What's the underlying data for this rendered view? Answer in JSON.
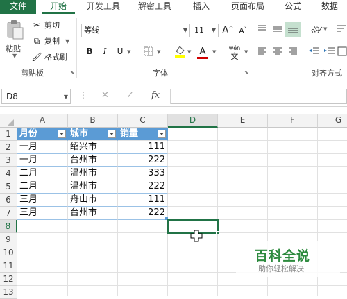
{
  "ribbon_tabs": {
    "file": "文件",
    "home": "开始",
    "developer": "开发工具",
    "decrypt": "解密工具",
    "insert": "插入",
    "page_layout": "页面布局",
    "formulas": "公式",
    "data": "数据"
  },
  "clipboard": {
    "paste": "粘贴",
    "cut": "剪切",
    "copy": "复制",
    "format_painter": "格式刷",
    "group_label": "剪贴板"
  },
  "font": {
    "name": "等线",
    "size": "11",
    "bold": "B",
    "italic": "I",
    "underline": "U",
    "grow": "A",
    "shrink": "A",
    "wen": "wén",
    "group_label": "字体",
    "highlight_color": "#ffff00",
    "font_color": "#d00000"
  },
  "alignment": {
    "group_label": "对齐方式"
  },
  "formula_bar": {
    "name_box": "D8",
    "cancel": "✕",
    "confirm": "✓",
    "fx": "fx",
    "value": ""
  },
  "columns": [
    "A",
    "B",
    "C",
    "D",
    "E",
    "F",
    "G"
  ],
  "rows": [
    "1",
    "2",
    "3",
    "4",
    "5",
    "6",
    "7",
    "8",
    "9",
    "10",
    "11",
    "12",
    "13"
  ],
  "table": {
    "headers": [
      "月份",
      "城市",
      "销量"
    ],
    "rows": [
      [
        "一月",
        "绍兴市",
        "111"
      ],
      [
        "一月",
        "台州市",
        "222"
      ],
      [
        "二月",
        "温州市",
        "333"
      ],
      [
        "二月",
        "温州市",
        "222"
      ],
      [
        "三月",
        "舟山市",
        "111"
      ],
      [
        "三月",
        "台州市",
        "222"
      ]
    ]
  },
  "selected_cell": "D8",
  "watermark": {
    "title": "百科全说",
    "subtitle": "助你轻松解决"
  },
  "colors": {
    "excel_green": "#217346",
    "table_header": "#5b9bd5",
    "watermark_green": "#2d8a3e"
  }
}
